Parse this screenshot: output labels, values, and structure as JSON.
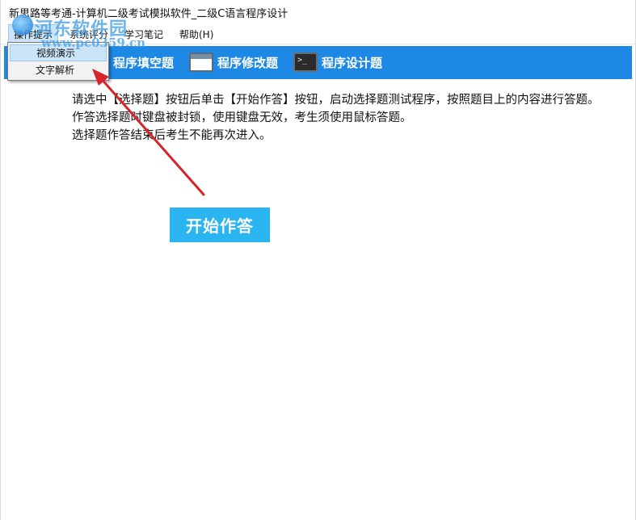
{
  "window": {
    "title": "新思路等考通-计算机二级考试模拟软件_二级C语言程序设计"
  },
  "menubar": {
    "items": [
      {
        "label": "操作提示"
      },
      {
        "label": "系统评分"
      },
      {
        "label": "学习笔记"
      },
      {
        "label": "帮助(H)"
      }
    ]
  },
  "dropdown": {
    "items": [
      {
        "label": "视频演示"
      },
      {
        "label": "文字解析"
      }
    ]
  },
  "toolbar": {
    "items": [
      {
        "label": "程序填空题",
        "icon": "edit-icon"
      },
      {
        "label": "程序修改题",
        "icon": "window-icon"
      },
      {
        "label": "程序设计题",
        "icon": "terminal-icon"
      }
    ]
  },
  "instructions": {
    "paragraphs": [
      "请选中【选择题】按钮后单击【开始作答】按钮，启动选择题测试程序，按照题目上的内容进行答题。",
      "作答选择题时键盘被封锁，使用键盘无效，考生须使用鼠标答题。",
      "选择题作答结束后考生不能再次进入。"
    ]
  },
  "start_button": {
    "label": "开始作答"
  },
  "watermark": {
    "name": "河东软件园",
    "url": "www.pc0359.cn"
  },
  "colors": {
    "toolbar_bg": "#1e88e5",
    "start_button_bg": "#2bb5f0",
    "annotation_arrow": "#d6242a"
  }
}
